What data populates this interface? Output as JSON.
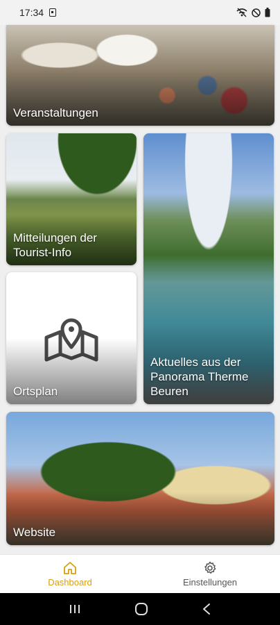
{
  "status_bar": {
    "time": "17:34"
  },
  "tiles": [
    {
      "label": "Veranstaltungen"
    },
    {
      "label": "Mitteilungen der\nTourist-Info"
    },
    {
      "label": "Aktuelles aus der\nPanorama Therme\nBeuren"
    },
    {
      "label": "Ortsplan"
    },
    {
      "label": "Website"
    }
  ],
  "bottom_nav": {
    "items": [
      {
        "label": "Dashboard",
        "icon": "home-icon",
        "active": true
      },
      {
        "label": "Einstellungen",
        "icon": "gear-icon",
        "active": false
      }
    ]
  },
  "colors": {
    "accent": "#d8a10a",
    "background": "#efefef"
  }
}
